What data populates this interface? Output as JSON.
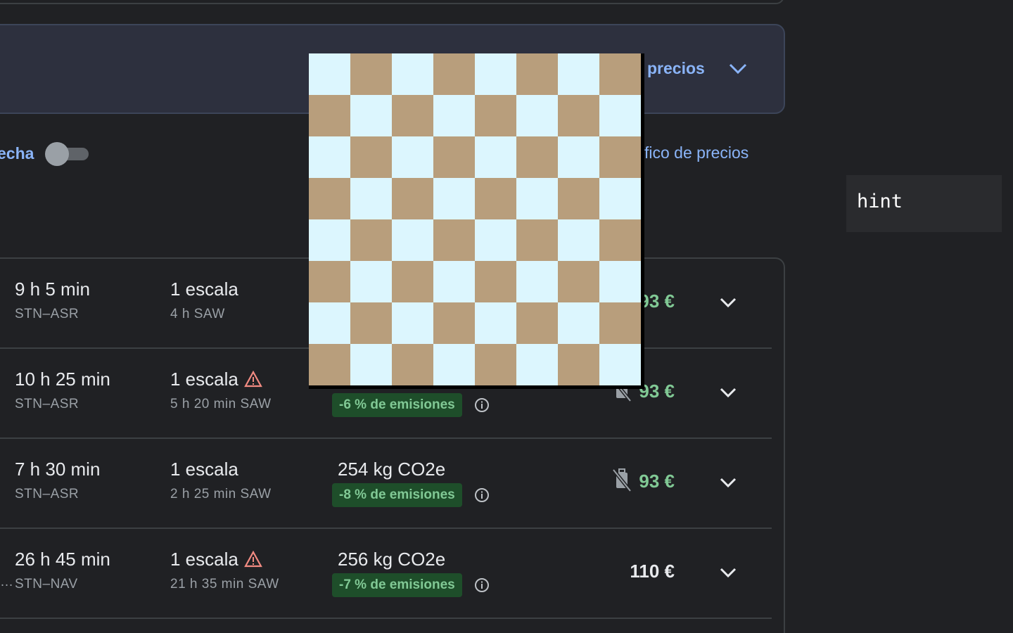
{
  "insight": {
    "link_label": "precios"
  },
  "filters": {
    "date_label": "echa",
    "graph_link": "fico de precios"
  },
  "hint": {
    "text": "hint"
  },
  "flights": [
    {
      "duration": "9 h 5 min",
      "route": "STN–ASR",
      "stops": "1 escala",
      "warning": false,
      "layover": "4 h SAW",
      "co2": "",
      "emissions": "",
      "price": "93 €",
      "price_color": "#81c995",
      "no_bag_icon": false
    },
    {
      "duration": "10 h 25 min",
      "route": "STN–ASR",
      "stops": "1 escala",
      "warning": true,
      "layover": "5 h 20 min SAW",
      "co2": "",
      "emissions": "-6 % de emisiones",
      "price": "93 €",
      "price_color": "#81c995",
      "no_bag_icon": true
    },
    {
      "duration": "7 h 30 min",
      "route": "STN–ASR",
      "stops": "1 escala",
      "warning": false,
      "layover": "2 h 25 min SAW",
      "co2": "254 kg CO2e",
      "emissions": "-8 % de emisiones",
      "price": "93 €",
      "price_color": "#81c995",
      "no_bag_icon": true
    },
    {
      "duration": "26 h 45 min",
      "route": "STN–NAV",
      "stops": "1 escala",
      "warning": true,
      "layover": "21 h 35 min SAW",
      "co2": "256 kg CO2e",
      "emissions": "-7 % de emisiones",
      "price": "110 €",
      "price_color": "#e8eaed",
      "no_bag_icon": false
    }
  ],
  "truncated_text": "…",
  "colors": {
    "background": "#202124",
    "accent_link": "#8ab4f8",
    "price_green": "#81c995",
    "emissions_badge_bg": "#1e4e2a",
    "warning": "#f28b82",
    "board_light": "#dcf6fe",
    "board_dark": "#b89e7c"
  }
}
